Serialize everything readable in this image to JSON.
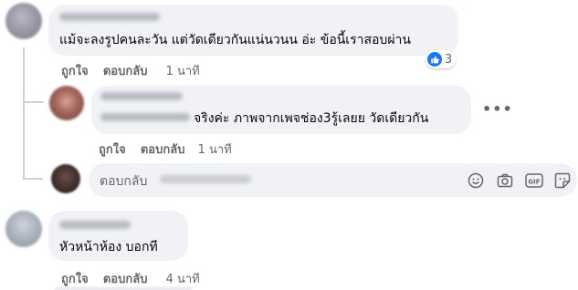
{
  "comments": [
    {
      "text": "แม้จะลงรูปคนละวัน แต่วัดเดียวกันแน่นวนน อ่ะ ข้อนี้เราสอบผ่าน",
      "like_label": "ถูกใจ",
      "reply_label": "ตอบกลับ",
      "time": "1 นาที",
      "reaction_count": "3",
      "reaction_icon": "like-icon"
    },
    {
      "text": "จริงค่ะ ภาพจากเพจช่อง3รู้เลยย วัดเดียวกัน",
      "like_label": "ถูกใจ",
      "reply_label": "ตอบกลับ",
      "time": "1 นาที"
    },
    {
      "text": "หัวหน้าห้อง บอกที",
      "like_label": "ถูกใจ",
      "reply_label": "ตอบกลับ",
      "time": "4 นาที"
    }
  ],
  "reply_box": {
    "placeholder": "ตอบกลับ",
    "icons": [
      "emoji-icon",
      "camera-icon",
      "gif-icon",
      "sticker-icon"
    ]
  },
  "more_options": "•••",
  "colors": {
    "bubble": "#f0f2f5",
    "meta_text": "#65676b",
    "like_blue": "#1877f2"
  }
}
